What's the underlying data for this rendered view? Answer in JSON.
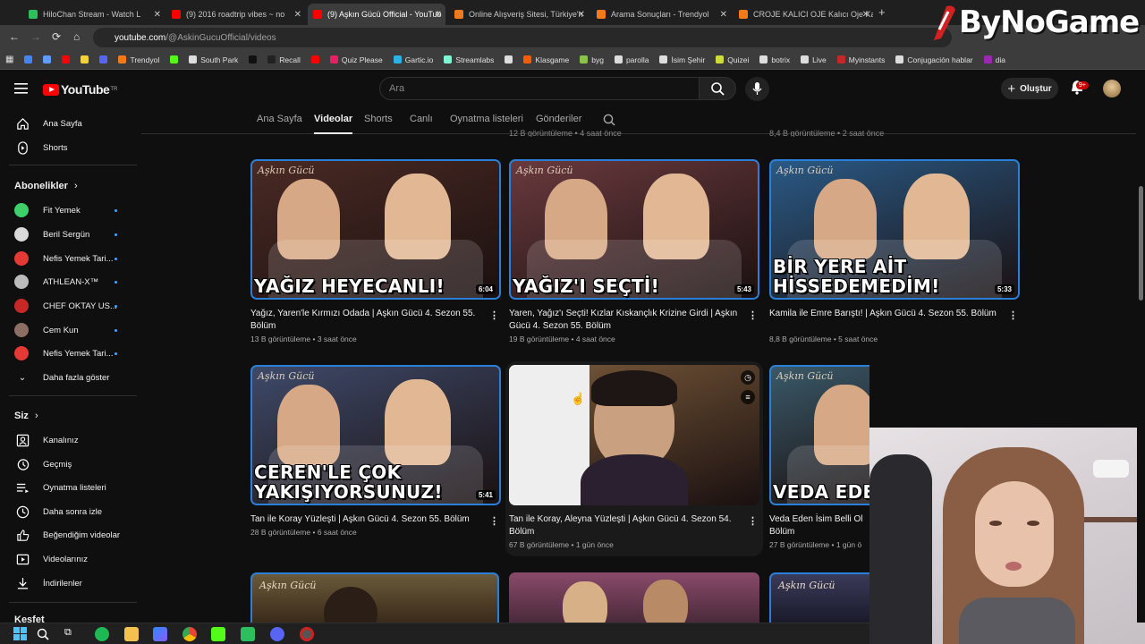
{
  "browser": {
    "tabs": [
      {
        "title": "HiloChan Stream - Watch L",
        "color": "#2dbe60"
      },
      {
        "title": "(9) 2016 roadtrip vibes ~ no",
        "color": "#ff0000"
      },
      {
        "title": "(9) Aşkın Gücü Official - YouTub",
        "color": "#ff0000",
        "active": true
      },
      {
        "title": "Online Alışveriş Sitesi, Türkiye'n",
        "color": "#f27a1a"
      },
      {
        "title": "Arama Sonuçları - Trendyol",
        "color": "#f27a1a"
      },
      {
        "title": "CROJE KALICI OJE Kalıcı Oje Ka",
        "color": "#f27a1a"
      }
    ],
    "url_host": "youtube.com",
    "url_path": "/@AskinGucuOfficial/videos",
    "bookmarks": [
      {
        "label": "",
        "color": "#4285f4"
      },
      {
        "label": "",
        "color": "#5f9bff"
      },
      {
        "label": "",
        "color": "#ff0000"
      },
      {
        "label": "",
        "color": "#f4d03f"
      },
      {
        "label": "",
        "color": "#5865f2"
      },
      {
        "label": "Trendyol",
        "color": "#f27a1a"
      },
      {
        "label": "",
        "color": "#53fc18"
      },
      {
        "label": "South Park",
        "color": "#dddddd"
      },
      {
        "label": "",
        "color": "#111111"
      },
      {
        "label": "Recall",
        "color": "#222222"
      },
      {
        "label": "",
        "color": "#ff0000"
      },
      {
        "label": "Quiz Please",
        "color": "#e91e63"
      },
      {
        "label": "Gartic.io",
        "color": "#2bb3e6"
      },
      {
        "label": "Streamlabs",
        "color": "#80f5d2"
      },
      {
        "label": "",
        "color": "#dddddd"
      },
      {
        "label": "Klasgame",
        "color": "#ff5a00"
      },
      {
        "label": "byg",
        "color": "#8bc34a"
      },
      {
        "label": "parolla",
        "color": "#dddddd"
      },
      {
        "label": "İsim Şehir",
        "color": "#dddddd"
      },
      {
        "label": "Quizei",
        "color": "#cddc39"
      },
      {
        "label": "botrix",
        "color": "#dddddd"
      },
      {
        "label": "Live",
        "color": "#dddddd"
      },
      {
        "label": "Myinstants",
        "color": "#c62828"
      },
      {
        "label": "Conjugación hablar",
        "color": "#dddddd"
      },
      {
        "label": "dia",
        "color": "#9c27b0"
      }
    ]
  },
  "overlay": {
    "logo_text": "ByNoGame"
  },
  "youtube": {
    "logo_text": "YouTube",
    "logo_sup": "TR",
    "search_placeholder": "Ara",
    "create_label": "Oluştur",
    "notif_badge": "9+"
  },
  "sidebar": {
    "main": [
      {
        "label": "Ana Sayfa",
        "icon": "home-icon"
      },
      {
        "label": "Shorts",
        "icon": "shorts-icon"
      }
    ],
    "subs_header": "Abonelikler",
    "subs": [
      {
        "label": "Fit Yemek",
        "color": "#3ecf6a"
      },
      {
        "label": "Beril Sergün",
        "color": "#d9d9d9"
      },
      {
        "label": "Nefis Yemek Tari...",
        "color": "#e53935"
      },
      {
        "label": "ATHLEAN-X™",
        "color": "#bbbbbb"
      },
      {
        "label": "CHEF OKTAY US...",
        "color": "#c62828"
      },
      {
        "label": "Cem Kun",
        "color": "#8d6e63"
      },
      {
        "label": "Nefis Yemek Tari...",
        "color": "#e53935"
      }
    ],
    "show_more": "Daha fazla göster",
    "you_header": "Siz",
    "you": [
      {
        "label": "Kanalınız",
        "icon": "channel-icon"
      },
      {
        "label": "Geçmiş",
        "icon": "history-icon"
      },
      {
        "label": "Oynatma listeleri",
        "icon": "playlists-icon"
      },
      {
        "label": "Daha sonra izle",
        "icon": "watch-later-icon"
      },
      {
        "label": "Beğendiğim videolar",
        "icon": "like-icon"
      },
      {
        "label": "Videolarınız",
        "icon": "your-videos-icon"
      },
      {
        "label": "İndirilenler",
        "icon": "downloads-icon"
      }
    ],
    "explore_header": "Keşfet"
  },
  "channel_tabs": [
    "Ana Sayfa",
    "Videolar",
    "Shorts",
    "Canlı",
    "Oynatma listeleri",
    "Gönderiler"
  ],
  "top_row_meta": [
    "12 B görüntüleme • 4 saat önce",
    "8,4 B görüntüleme • 2 saat önce"
  ],
  "videos": [
    {
      "caption": "YAĞIZ HEYECANLI!",
      "duration": "6:04",
      "title": "Yağız, Yaren'le Kırmızı Odada | Aşkın Gücü 4. Sezon 55. Bölüm",
      "views": "13 B görüntüleme",
      "age": "3 saat önce",
      "bg": "#4a2a24"
    },
    {
      "caption": "YAĞIZ'I SEÇTİ!",
      "duration": "5:43",
      "title": "Yaren, Yağız'ı Seçti! Kızlar Kıskançlık Krizine Girdi | Aşkın Gücü 4. Sezon 55. Bölüm",
      "views": "19 B görüntüleme",
      "age": "4 saat önce",
      "bg": "#6a3a3e"
    },
    {
      "caption": "BİR YERE AİT HİSSEDEMEDİM!",
      "duration": "5:33",
      "title": "Kamila ile Emre Barıştı! | Aşkın Gücü 4. Sezon 55. Bölüm",
      "views": "8,8 B görüntüleme",
      "age": "5 saat önce",
      "bg": "#2a5a86"
    },
    {
      "caption": "CEREN'LE ÇOK YAKIŞIYORSUNUZ!",
      "duration": "5:41",
      "title": "Tan ile Koray Yüzleşti | Aşkın Gücü 4. Sezon 55. Bölüm",
      "views": "28 B görüntüleme",
      "age": "6 saat önce",
      "bg": "#3e4a6a"
    },
    {
      "caption": "",
      "duration": "",
      "title": "Tan ile Koray, Aleyna Yüzleşti | Aşkın Gücü 4. Sezon 54. Bölüm",
      "views": "67 B görüntüleme",
      "age": "1 gün önce",
      "bg": "#7a5a3a"
    },
    {
      "caption": "VEDA EDEN İSİM",
      "duration": "",
      "title": "Veda Eden İsim Belli Ol",
      "title2": "Bölüm",
      "views": "27 B görüntüleme",
      "age": "1 gün ö",
      "bg": "#3a5a6a"
    }
  ],
  "thumb_brand": "Aşkın Gücü",
  "colors": {
    "accent": "#ff0000",
    "link": "#3ea6ff",
    "bg": "#0f0f0f"
  }
}
